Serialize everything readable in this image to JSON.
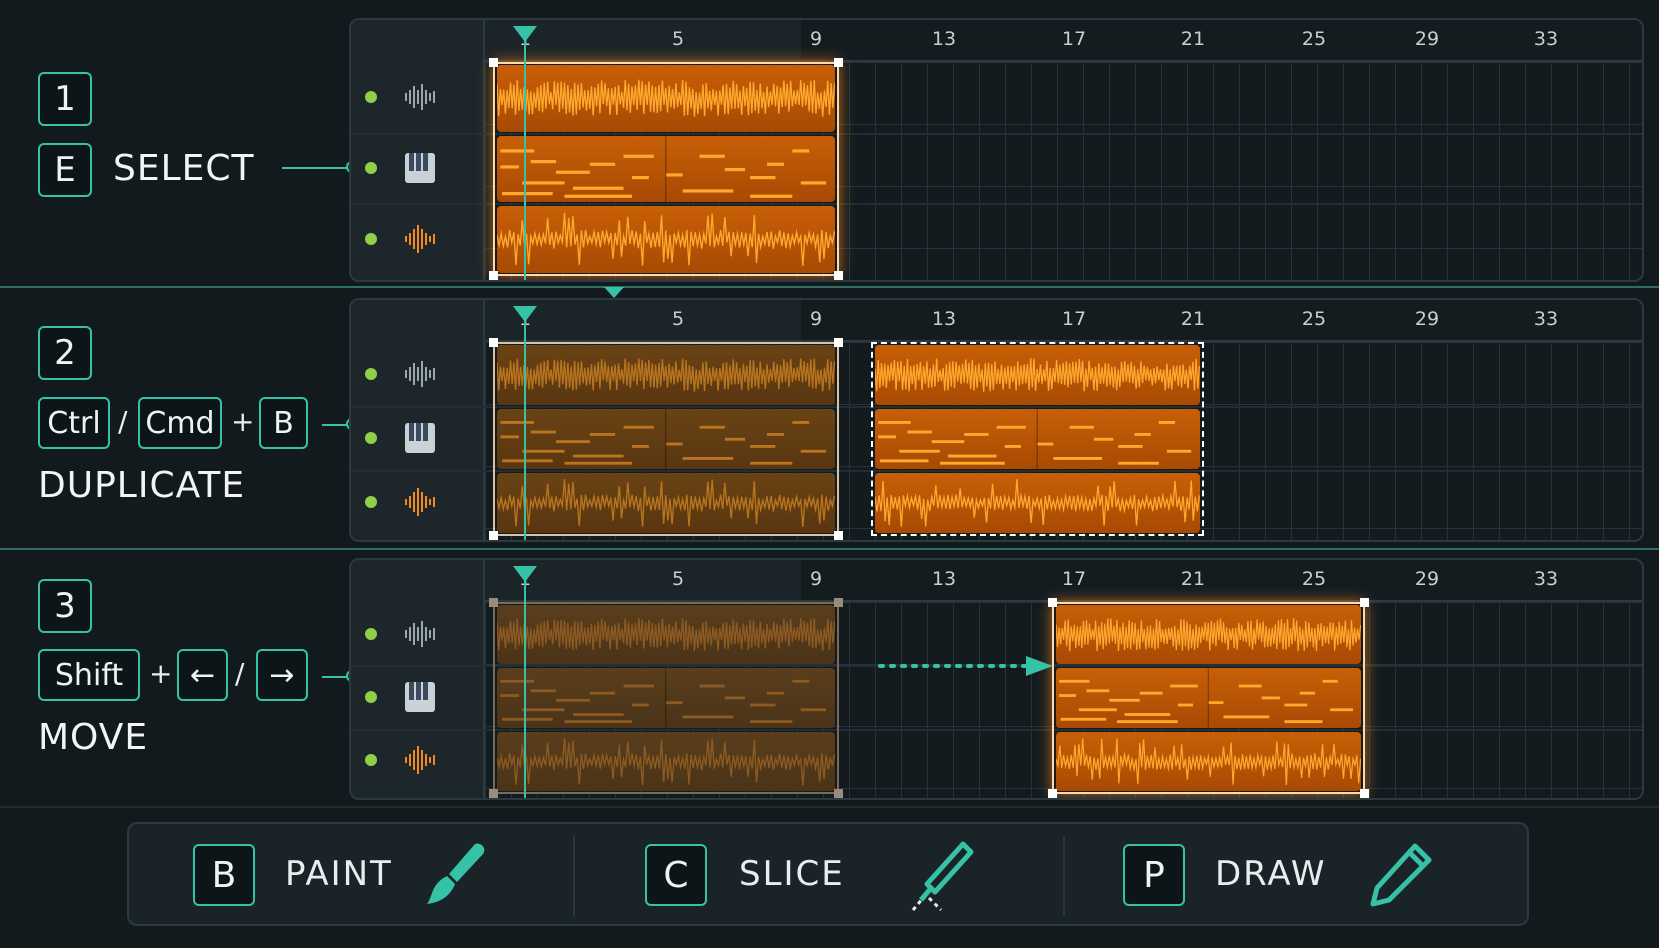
{
  "ruler_ticks": [
    "1",
    "5",
    "9",
    "13",
    "17",
    "21",
    "25",
    "29",
    "33"
  ],
  "steps": [
    {
      "number": "1",
      "shortcut_key": "E",
      "action": "SELECT"
    },
    {
      "number": "2",
      "keys": [
        "Ctrl",
        "Cmd",
        "B"
      ],
      "separator": "/",
      "plus": "+",
      "action": "DUPLICATE"
    },
    {
      "number": "3",
      "keys": [
        "Shift",
        "←",
        "→"
      ],
      "separator": "/",
      "plus": "+",
      "action": "MOVE"
    }
  ],
  "tracks": [
    {
      "icon": "audio-waveform-icon",
      "color": "#9aa6aa",
      "enabled": true
    },
    {
      "icon": "piano-keys-icon",
      "color": "#b9c3c6",
      "enabled": true
    },
    {
      "icon": "drum-waveform-icon",
      "color": "#f28b1c",
      "enabled": true
    }
  ],
  "toolbar": {
    "tools": [
      {
        "key": "B",
        "name": "PAINT",
        "icon": "paintbrush-icon"
      },
      {
        "key": "C",
        "name": "SLICE",
        "icon": "knife-slice-icon"
      },
      {
        "key": "P",
        "name": "DRAW",
        "icon": "pencil-icon"
      }
    ]
  },
  "colors": {
    "accent": "#35c2a6",
    "clip_orange": "#c85f07",
    "waveform": "#ffa82e",
    "background": "#121a1e",
    "track_on": "#8fd146"
  }
}
